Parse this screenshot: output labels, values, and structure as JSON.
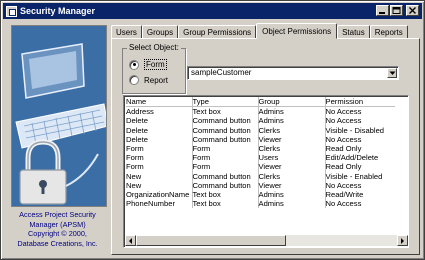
{
  "window": {
    "title": "Security Manager"
  },
  "sidebar": {
    "credits": [
      "Access Project Security",
      "Manager (APSM)",
      "Copyright © 2000,",
      "Database Creations, Inc."
    ]
  },
  "tabs": [
    {
      "label": "Users",
      "active": false
    },
    {
      "label": "Groups",
      "active": false
    },
    {
      "label": "Group Permissions",
      "active": false
    },
    {
      "label": "Object Permissions",
      "active": true
    },
    {
      "label": "Status",
      "active": false
    },
    {
      "label": "Reports",
      "active": false
    }
  ],
  "select_object": {
    "legend": "Select Object:",
    "options": [
      {
        "label": "Form",
        "selected": true
      },
      {
        "label": "Report",
        "selected": false
      }
    ]
  },
  "object_combo": {
    "value": "sampleCustomer"
  },
  "permissions_table": {
    "columns": [
      "Name",
      "Type",
      "Group",
      "Permission"
    ],
    "rows": [
      [
        "Address",
        "Text box",
        "Admins",
        "No Access"
      ],
      [
        "Delete",
        "Command button",
        "Admins",
        "No Access"
      ],
      [
        "Delete",
        "Command button",
        "Clerks",
        "Visible - Disabled"
      ],
      [
        "Delete",
        "Command button",
        "Viewer",
        "No Access"
      ],
      [
        "Form",
        "Form",
        "Clerks",
        "Read Only"
      ],
      [
        "Form",
        "Form",
        "Users",
        "Edit/Add/Delete"
      ],
      [
        "Form",
        "Form",
        "Viewer",
        "Read Only"
      ],
      [
        "New",
        "Command button",
        "Clerks",
        "Visible - Enabled"
      ],
      [
        "New",
        "Command button",
        "Viewer",
        "No Access"
      ],
      [
        "OrganizationName",
        "Text box",
        "Admins",
        "Read/Write"
      ],
      [
        "PhoneNumber",
        "Text box",
        "Admins",
        "No Access"
      ]
    ]
  },
  "colors": {
    "titlebar": "#0a246a",
    "face": "#d4d0c8",
    "art_bg": "#3a6ea5",
    "credits": "#000080"
  }
}
